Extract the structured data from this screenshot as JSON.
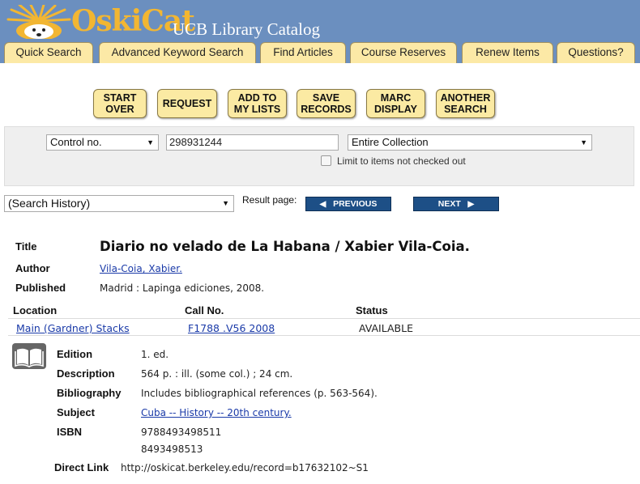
{
  "header": {
    "logo_text": "OskiCat",
    "subtitle": "UCB Library Catalog"
  },
  "tabs": [
    "Quick Search",
    "Advanced Keyword Search",
    "Find Articles",
    "Course Reserves",
    "Renew Items",
    "Questions?"
  ],
  "actions": {
    "start_over": [
      "START",
      "OVER"
    ],
    "request": [
      "REQUEST"
    ],
    "add_to_lists": [
      "ADD TO",
      "MY LISTS"
    ],
    "save_records": [
      "SAVE",
      "RECORDS"
    ],
    "marc_display": [
      "MARC",
      "DISPLAY"
    ],
    "another_search": [
      "ANOTHER",
      "SEARCH"
    ]
  },
  "search": {
    "field_select": "Control no.",
    "query": "298931244",
    "scope_select": "Entire Collection",
    "limit_label": "Limit to items not checked out",
    "limit_checked": false
  },
  "history_select": "(Search History)",
  "result_page_label": "Result page:",
  "nav": {
    "previous": "PREVIOUS",
    "next": "NEXT"
  },
  "record": {
    "title_label": "Title",
    "title": "Diario no velado de La Habana / Xabier Vila-Coia.",
    "author_label": "Author",
    "author": "Vila-Coia, Xabier.",
    "published_label": "Published",
    "published": "Madrid : Lapinga ediciones, 2008."
  },
  "holdings": {
    "headers": {
      "location": "Location",
      "call_no": "Call No.",
      "status": "Status"
    },
    "row": {
      "location": "Main (Gardner) Stacks",
      "call_no": "F1788 .V56 2008",
      "status": "AVAILABLE"
    }
  },
  "details": {
    "edition_label": "Edition",
    "edition": "1. ed.",
    "description_label": "Description",
    "description": "564 p. : ill. (some col.) ; 24 cm.",
    "bibliography_label": "Bibliography",
    "bibliography": "Includes bibliographical references (p. 563-564).",
    "subject_label": "Subject",
    "subject": "Cuba -- History -- 20th century.",
    "isbn_label": "ISBN",
    "isbn1": "9788493498511",
    "isbn2": "8493498513",
    "direct_link_label": "Direct Link",
    "direct_link": "http://oskicat.berkeley.edu/record=b17632102~S1"
  },
  "icons": {
    "logo": "bear-mascot-icon",
    "dropdown": "chevron-down-icon",
    "prev": "triangle-left-icon",
    "next": "triangle-right-icon",
    "format": "book-icon"
  },
  "colors": {
    "header_bg": "#6b8fbf",
    "logo_gold": "#f2b632",
    "tab_bg": "#fce9a6",
    "nav_button": "#1d4f86",
    "link": "#1a3aa8"
  }
}
